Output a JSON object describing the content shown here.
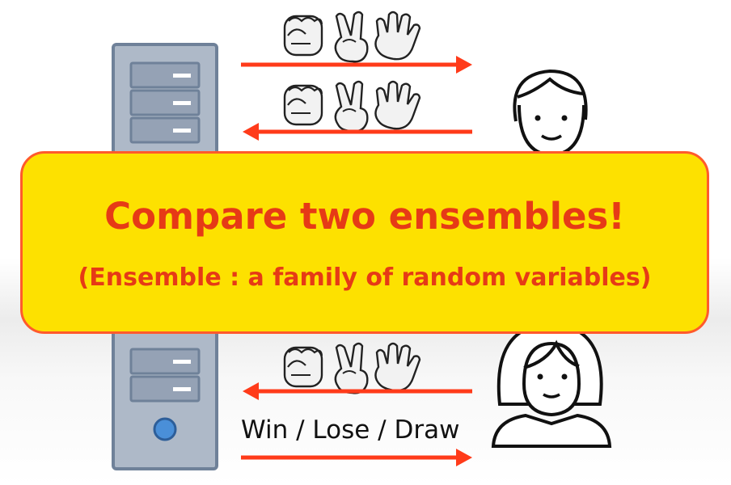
{
  "diagram": {
    "banner": {
      "title": "Compare two ensembles!",
      "subtitle": "(Ensemble : a family of random variables)"
    },
    "result_label": "Win / Lose / Draw",
    "colors": {
      "arrow": "#ff3b1a",
      "banner_fill": "#fde100",
      "banner_border": "#ff5a2c",
      "banner_text": "#e63a16",
      "server_fill": "#aeb9c8",
      "server_border": "#6f8199",
      "drive_bay": "#95a2b5",
      "power_light": "#4a8fd8"
    },
    "icons": [
      "server-icon",
      "fist-icon",
      "v-sign-hand-icon",
      "open-hand-icon",
      "man-face-icon",
      "woman-face-icon"
    ]
  }
}
